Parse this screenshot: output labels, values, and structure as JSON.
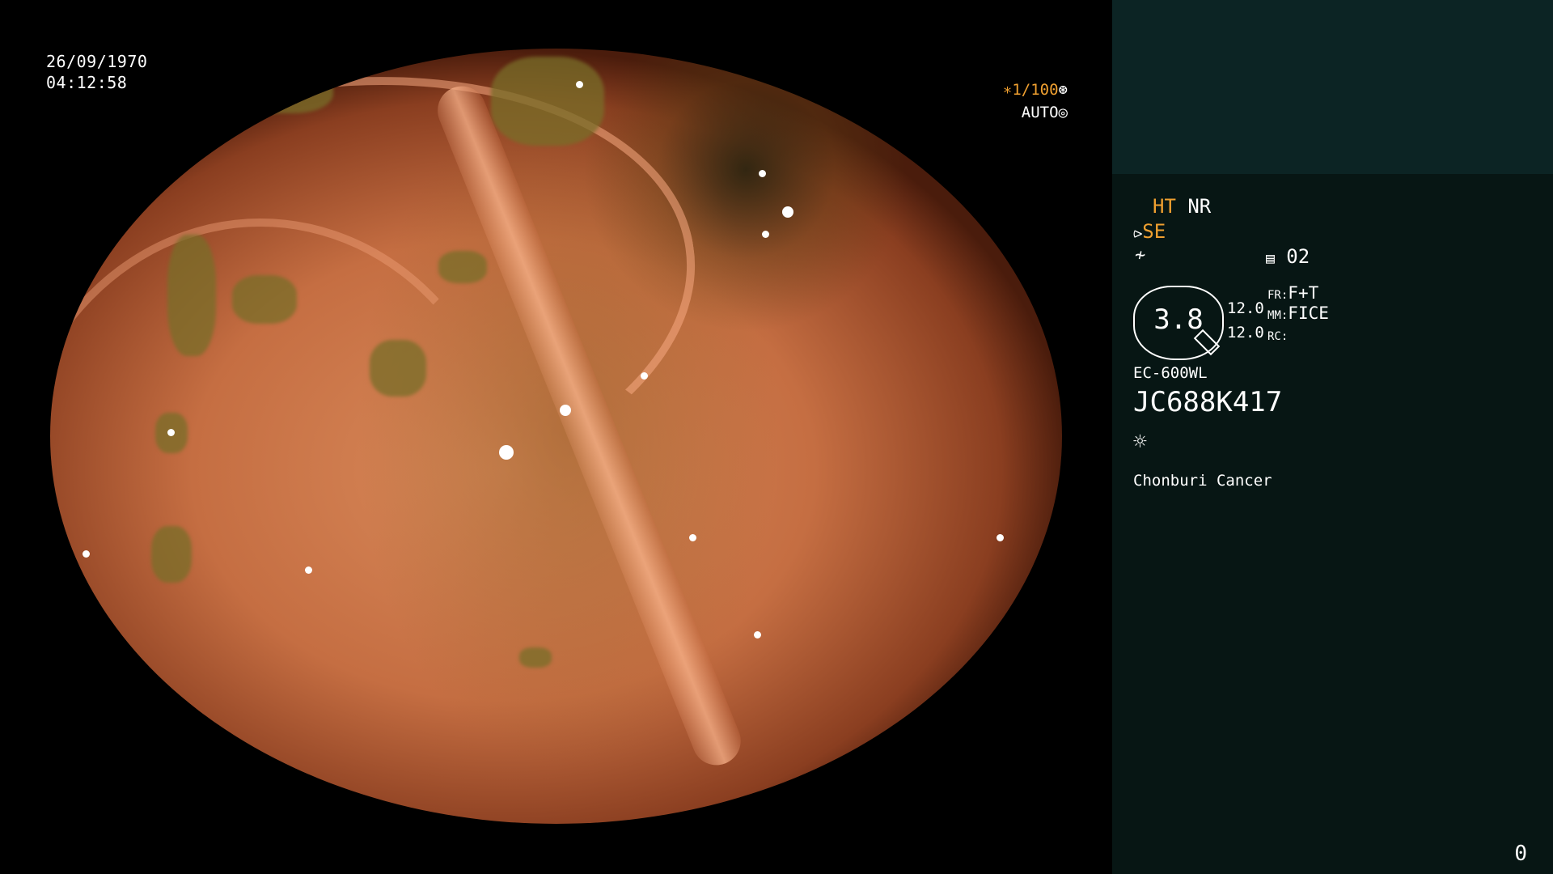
{
  "overlay": {
    "date": "26/09/1970",
    "time": "04:12:58",
    "shutter": "∗1/100",
    "exposure_mode": "AUTO"
  },
  "panel": {
    "ht_label": "HT",
    "nr_label": "NR",
    "se_label": "SE",
    "memory_value": "02",
    "dial_value": "3.8",
    "scale_top": "12.0",
    "scale_bottom": "12.0",
    "fr_key": "FR:",
    "fr_value": "F+T",
    "mm_key": "MM:",
    "mm_value": "FICE",
    "rc_key": "RC:",
    "model": "EC-600WL",
    "serial": "JC688K417",
    "institution": "Chonburi Cancer",
    "counter": "0"
  },
  "colors": {
    "accent_orange": "#f0a030",
    "panel_top": "#0c2424",
    "panel_bottom": "#071614"
  },
  "icons": [
    "shutter-icon",
    "auto-exposure-icon",
    "scope-tip-icon",
    "freeze-icon",
    "memory-icon",
    "light-icon"
  ]
}
